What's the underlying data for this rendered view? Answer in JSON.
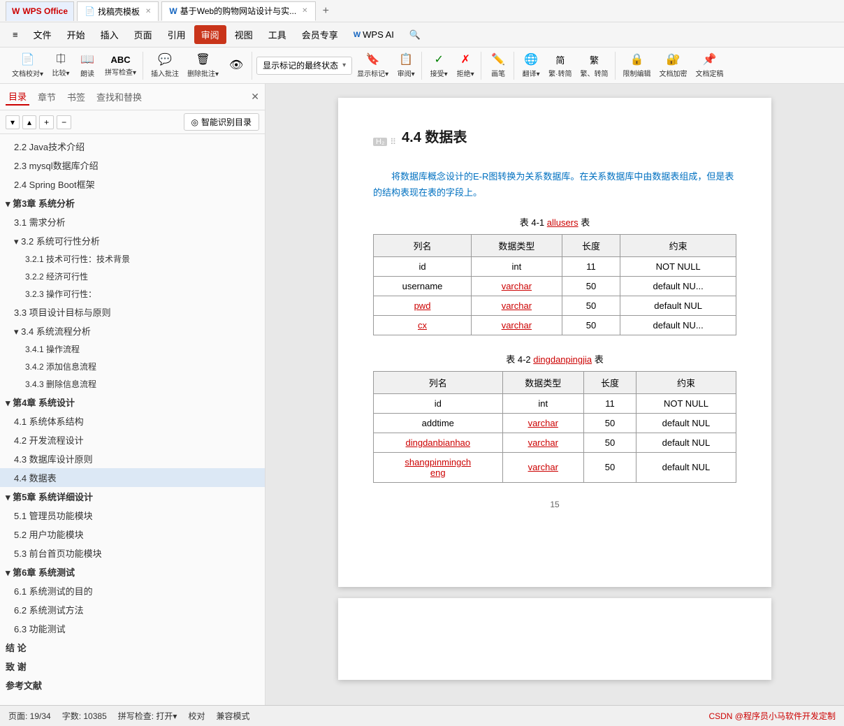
{
  "titlebar": {
    "tabs": [
      {
        "id": "wps",
        "label": "WPS Office",
        "icon": "W",
        "active": false
      },
      {
        "id": "template",
        "label": "找稿壳模板",
        "icon": "📄",
        "active": false
      },
      {
        "id": "doc",
        "label": "基于Web的购物网站设计与实...",
        "icon": "W",
        "active": true
      }
    ],
    "new_tab": "+"
  },
  "menubar": {
    "hamburger": "≡",
    "items": [
      {
        "id": "file",
        "label": "文件"
      },
      {
        "id": "start",
        "label": "开始"
      },
      {
        "id": "insert",
        "label": "插入"
      },
      {
        "id": "page",
        "label": "页面"
      },
      {
        "id": "cite",
        "label": "引用"
      },
      {
        "id": "review",
        "label": "审阅",
        "active": true
      },
      {
        "id": "view",
        "label": "视图"
      },
      {
        "id": "tools",
        "label": "工具"
      },
      {
        "id": "member",
        "label": "会员专享"
      },
      {
        "id": "wpsai",
        "label": "WPS AI"
      },
      {
        "id": "search",
        "label": "🔍"
      }
    ]
  },
  "toolbar": {
    "groups": [
      {
        "id": "compare",
        "items": [
          {
            "id": "doccompare",
            "icon": "📄",
            "label": "文档校对▾"
          },
          {
            "id": "compare",
            "icon": "⎅",
            "label": "比较▾"
          },
          {
            "id": "read",
            "icon": "📖",
            "label": "朗读"
          },
          {
            "id": "spell",
            "icon": "ABC",
            "label": "拼写检查▾"
          }
        ]
      },
      {
        "id": "comment",
        "items": [
          {
            "id": "addnote",
            "icon": "💬",
            "label": "插入批注"
          },
          {
            "id": "delnote",
            "icon": "🗑",
            "label": "删除批注▾"
          },
          {
            "id": "shownote",
            "icon": "👁",
            "label": ""
          }
        ]
      },
      {
        "id": "track",
        "items": [
          {
            "id": "trackdropdown",
            "label": "显示标记的最终状态",
            "dropdown": true
          },
          {
            "id": "showmark",
            "icon": "🔖",
            "label": "显示标记▾"
          },
          {
            "id": "review2",
            "icon": "📋",
            "label": "审阅▾"
          }
        ]
      },
      {
        "id": "accept",
        "items": [
          {
            "id": "accept",
            "icon": "✓",
            "label": "接受▾"
          },
          {
            "id": "reject",
            "icon": "✗",
            "label": "拒绝▾"
          }
        ]
      },
      {
        "id": "draw",
        "items": [
          {
            "id": "draw",
            "icon": "✏️",
            "label": "画笔"
          }
        ]
      },
      {
        "id": "translate",
        "items": [
          {
            "id": "translate",
            "icon": "🌐",
            "label": "翻译▾"
          },
          {
            "id": "trad",
            "icon": "繁",
            "label": "繁·转简"
          },
          {
            "id": "simp",
            "icon": "简",
            "label": "繁、转简"
          }
        ]
      },
      {
        "id": "protect",
        "items": [
          {
            "id": "restrictedit",
            "icon": "🔒",
            "label": "限制编辑"
          },
          {
            "id": "encrypt",
            "icon": "🔐",
            "label": "文档加密"
          },
          {
            "id": "finalmark",
            "icon": "📌",
            "label": "文档定稿"
          }
        ]
      }
    ]
  },
  "sidebar": {
    "tabs": [
      "目录",
      "章节",
      "书签",
      "查找和替换"
    ],
    "active_tab": "目录",
    "nav_buttons": [
      "▾",
      "▴",
      "+",
      "−"
    ],
    "smart_btn": "智能识别目录",
    "toc": [
      {
        "level": 2,
        "label": "2.2 Java技术介绍",
        "expanded": false,
        "active": false
      },
      {
        "level": 2,
        "label": "2.3 mysql数据库介绍",
        "expanded": false,
        "active": false
      },
      {
        "level": 2,
        "label": "2.4 Spring Boot框架",
        "expanded": false,
        "active": false
      },
      {
        "level": 1,
        "label": "▾ 第3章 系统分析",
        "expanded": true,
        "active": false
      },
      {
        "level": 2,
        "label": "3.1 需求分析",
        "expanded": false,
        "active": false
      },
      {
        "level": 2,
        "label": "▾ 3.2 系统可行性分析",
        "expanded": true,
        "active": false
      },
      {
        "level": 3,
        "label": "3.2.1 技术可行性：技术背景",
        "expanded": false,
        "active": false
      },
      {
        "level": 3,
        "label": "3.2.2 经济可行性",
        "expanded": false,
        "active": false
      },
      {
        "level": 3,
        "label": "3.2.3 操作可行性：",
        "expanded": false,
        "active": false
      },
      {
        "level": 2,
        "label": "3.3 项目设计目标与原则",
        "expanded": false,
        "active": false
      },
      {
        "level": 2,
        "label": "▾ 3.4 系统流程分析",
        "expanded": true,
        "active": false
      },
      {
        "level": 3,
        "label": "3.4.1 操作流程",
        "expanded": false,
        "active": false
      },
      {
        "level": 3,
        "label": "3.4.2 添加信息流程",
        "expanded": false,
        "active": false
      },
      {
        "level": 3,
        "label": "3.4.3 删除信息流程",
        "expanded": false,
        "active": false
      },
      {
        "level": 1,
        "label": "▾ 第4章 系统设计",
        "expanded": true,
        "active": false
      },
      {
        "level": 2,
        "label": "4.1 系统体系结构",
        "expanded": false,
        "active": false
      },
      {
        "level": 2,
        "label": "4.2 开发流程设计",
        "expanded": false,
        "active": false
      },
      {
        "level": 2,
        "label": "4.3 数据库设计原则",
        "expanded": false,
        "active": false
      },
      {
        "level": 2,
        "label": "4.4 数据表",
        "expanded": false,
        "active": true
      },
      {
        "level": 1,
        "label": "▾ 第5章 系统详细设计",
        "expanded": true,
        "active": false
      },
      {
        "level": 2,
        "label": "5.1 管理员功能模块",
        "expanded": false,
        "active": false
      },
      {
        "level": 2,
        "label": "5.2 用户功能模块",
        "expanded": false,
        "active": false
      },
      {
        "level": 2,
        "label": "5.3 前台首页功能模块",
        "expanded": false,
        "active": false
      },
      {
        "level": 1,
        "label": "▾ 第6章 系统测试",
        "expanded": true,
        "active": false
      },
      {
        "level": 2,
        "label": "6.1 系统测试的目的",
        "expanded": false,
        "active": false
      },
      {
        "level": 2,
        "label": "6.2 系统测试方法",
        "expanded": false,
        "active": false
      },
      {
        "level": 2,
        "label": "6.3 功能测试",
        "expanded": false,
        "active": false
      },
      {
        "level": 1,
        "label": "结  论",
        "expanded": false,
        "active": false
      },
      {
        "level": 1,
        "label": "致  谢",
        "expanded": false,
        "active": false
      },
      {
        "level": 1,
        "label": "参考文献",
        "expanded": false,
        "active": false
      }
    ]
  },
  "document": {
    "section_heading": "4.4 数据表",
    "intro_text": "将数据库概念设计的E-R图转换为关系数据库。在关系数据库中由数据表组成，但是表的结构表现在表的字段上。",
    "table1": {
      "caption_prefix": "表 4-1",
      "caption_name": "allusers",
      "caption_suffix": "表",
      "columns": [
        "列名",
        "数据类型",
        "长度",
        "约束"
      ],
      "rows": [
        [
          "id",
          "int",
          "11",
          "NOT NULL"
        ],
        [
          "username",
          "varchar",
          "50",
          "default NU..."
        ],
        [
          "pwd",
          "varchar",
          "50",
          "default NUL"
        ],
        [
          "cx",
          "varchar",
          "50",
          "default NU..."
        ]
      ]
    },
    "table2": {
      "caption_prefix": "表 4-2",
      "caption_name": "dingdanpingjia",
      "caption_suffix": "表",
      "columns": [
        "列名",
        "数据类型",
        "长度",
        "约束"
      ],
      "rows": [
        [
          "id",
          "int",
          "11",
          "NOT NULL"
        ],
        [
          "addtime",
          "varchar",
          "50",
          "default NUL"
        ],
        [
          "dingdanbianhao",
          "varchar",
          "50",
          "default NUL"
        ],
        [
          "shangpinmingcheng",
          "varchar",
          "50",
          "default NUL"
        ]
      ]
    },
    "page_num": "15"
  },
  "statusbar": {
    "page": "页面: 19/34",
    "words": "字数: 10385",
    "spell": "拼写检查: 打开▾",
    "proofread": "校对",
    "compat": "兼容模式",
    "right_text": "CSDN @程序员小马软件开发定制"
  }
}
